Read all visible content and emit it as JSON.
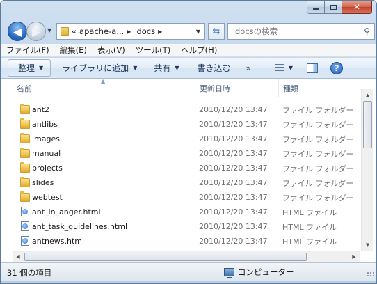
{
  "caption": {
    "minimize_icon": "minimize-icon",
    "maximize_icon": "maximize-icon",
    "close_glyph": "✕"
  },
  "nav": {
    "back_icon": "back-arrow-icon",
    "forward_icon": "forward-arrow-icon",
    "address": {
      "overflow": "«",
      "segments": [
        "apache-a...",
        "docs"
      ]
    },
    "search": {
      "placeholder": "docsの検索"
    }
  },
  "menubar": {
    "items": [
      "ファイル(F)",
      "編集(E)",
      "表示(V)",
      "ツール(T)",
      "ヘルプ(H)"
    ]
  },
  "commandbar": {
    "organize": "整理",
    "library": "ライブラリに追加",
    "share": "共有",
    "burn": "書き込む",
    "more": "»"
  },
  "columns": {
    "name": "名前",
    "date": "更新日時",
    "type": "種類"
  },
  "files": [
    {
      "name": "ant2",
      "date": "2010/12/20 13:47",
      "type": "ファイル フォルダー",
      "kind": "folder"
    },
    {
      "name": "antlibs",
      "date": "2010/12/20 13:47",
      "type": "ファイル フォルダー",
      "kind": "folder"
    },
    {
      "name": "images",
      "date": "2010/12/20 13:47",
      "type": "ファイル フォルダー",
      "kind": "folder"
    },
    {
      "name": "manual",
      "date": "2010/12/20 13:47",
      "type": "ファイル フォルダー",
      "kind": "folder"
    },
    {
      "name": "projects",
      "date": "2010/12/20 13:47",
      "type": "ファイル フォルダー",
      "kind": "folder"
    },
    {
      "name": "slides",
      "date": "2010/12/20 13:47",
      "type": "ファイル フォルダー",
      "kind": "folder"
    },
    {
      "name": "webtest",
      "date": "2010/12/20 13:47",
      "type": "ファイル フォルダー",
      "kind": "folder"
    },
    {
      "name": "ant_in_anger.html",
      "date": "2010/12/20 13:47",
      "type": "HTML ファイル",
      "kind": "html"
    },
    {
      "name": "ant_task_guidelines.html",
      "date": "2010/12/20 13:47",
      "type": "HTML ファイル",
      "kind": "html"
    },
    {
      "name": "antnews.html",
      "date": "2010/12/20 13:47",
      "type": "HTML ファイル",
      "kind": "html"
    }
  ],
  "status": {
    "count": "31 個の項目",
    "location": "コンピューター"
  }
}
